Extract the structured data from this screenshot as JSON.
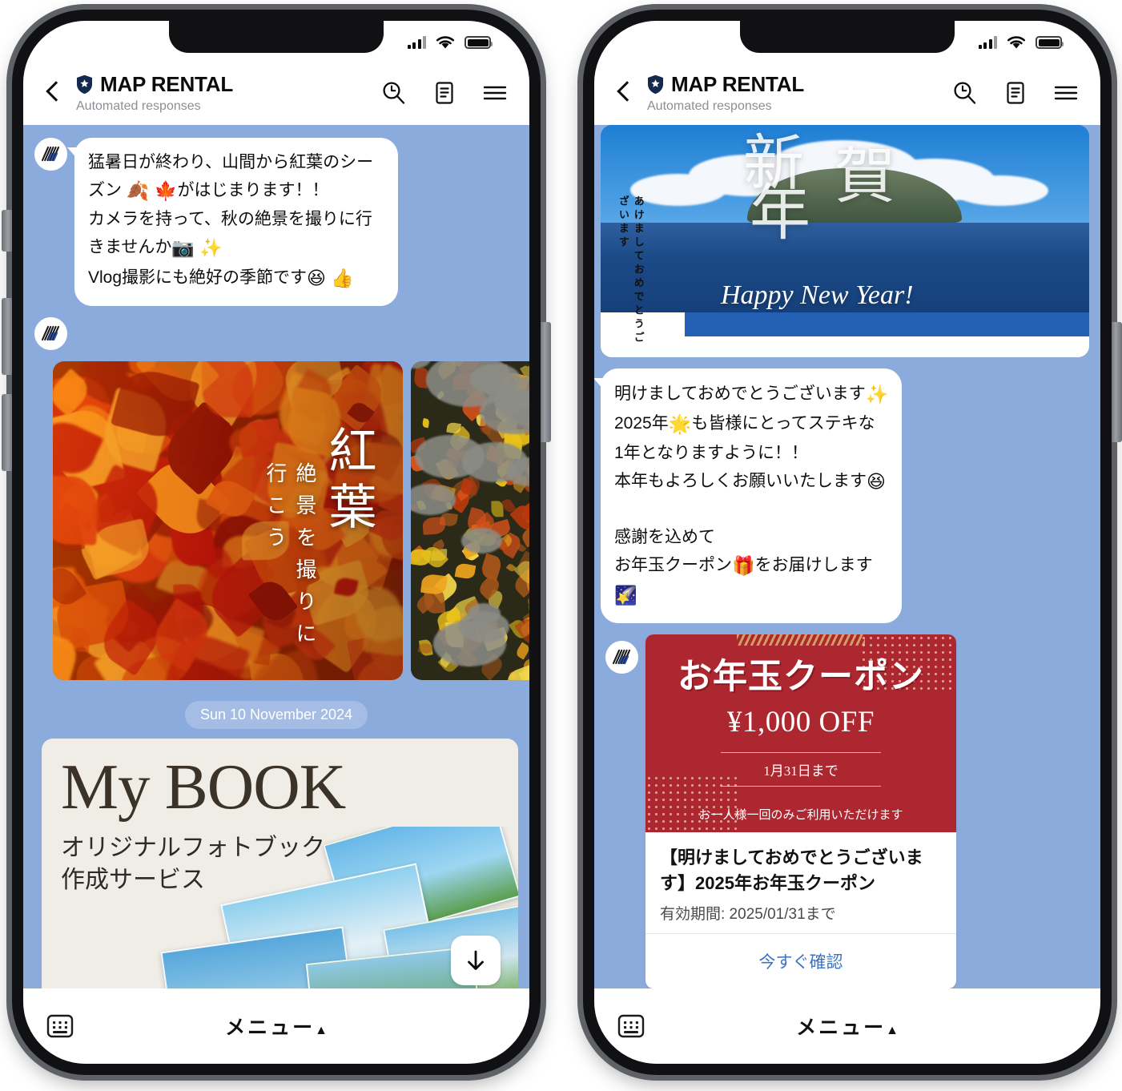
{
  "header": {
    "title": "MAP RENTAL",
    "subtitle": "Automated responses",
    "back_icon": "back-chevron-icon",
    "brand_icon": "shield-star-icon",
    "actions": [
      {
        "name": "search-history-icon",
        "label": "Search"
      },
      {
        "name": "note-icon",
        "label": "Notes"
      },
      {
        "name": "hamburger-menu-icon",
        "label": "Menu"
      }
    ]
  },
  "status_bar": {
    "signal": "cellular-signal-icon",
    "wifi": "wifi-icon",
    "battery": "battery-full-icon"
  },
  "bottom_bar": {
    "keyboard_icon": "keyboard-icon",
    "menu_label": "メニュー",
    "menu_caret": "▲"
  },
  "left_phone": {
    "message_1": {
      "lines": [
        "猛暑日が終わり、山間から紅葉のシーズン 🍂 🍁 がはじまります！！",
        "カメラを持って、秋の絶景を撮りに行きませんか📷 ✨",
        "Vlog撮影にも絶好の季節です😆 👍"
      ],
      "line1_a": "猛暑日が終わり、山間から紅葉のシー",
      "line1_b": "ズン ",
      "line1_emoji": "🍂 🍁",
      "line1_c": "がはじまります！！",
      "line2_a": "カメラを持って、秋の絶景を撮りに行",
      "line2_b": "きませんか",
      "line2_emoji": "📷 ✨",
      "line3_a": "Vlog撮影にも絶好の季節です",
      "line3_emoji": "😆 👍"
    },
    "carousel": [
      {
        "name": "autumn-momiji-card",
        "vertical_title": "紅葉",
        "vertical_subtitle": "絶景を撮りに行こう"
      },
      {
        "name": "fallen-leaves-card"
      }
    ],
    "date_divider": "Sun 10 November 2024",
    "mybook_card": {
      "title": "My BOOK",
      "subtitle_line1": "オリジナルフォトブック",
      "subtitle_line2": "作成サービス"
    },
    "scroll_down_icon": "arrow-down-icon"
  },
  "right_phone": {
    "newyear_card": {
      "kanji_1": "新",
      "kanji_2": "賀",
      "kanji_3": "年",
      "vertical_text": "あけましておめでとうございます",
      "script_text": "Happy New Year!"
    },
    "message_1": {
      "line1_a": "明けましておめでとうございます",
      "line1_emoji": "✨",
      "line2_a": "2025年",
      "line2_emoji": "🌟",
      "line2_b": "も皆様にとってステキな",
      "line3": "1年となりますように！！",
      "line4_a": "本年もよろしくお願いいたします",
      "line4_emoji": "😆",
      "line5": "感謝を込めて",
      "line6_a": "お年玉クーポン",
      "line6_emoji": "🎁",
      "line6_b": "をお届けします",
      "line7_emoji": "🌠"
    },
    "coupon": {
      "heading": "お年玉クーポン",
      "amount": "¥1,000 OFF",
      "until": "1月31日まで",
      "note": "お一人様一回のみご利用いただけます",
      "title": "【明けましておめでとうございます】2025年お年玉クーポン",
      "validity": "有効期間: 2025/01/31まで",
      "action": "今すぐ確認"
    }
  },
  "colors": {
    "chat_background": "#8cabdd",
    "bubble": "#ffffff",
    "brand_navy": "#1b2f55",
    "coupon_red": "#ad2730",
    "link_blue": "#3b74c4"
  }
}
